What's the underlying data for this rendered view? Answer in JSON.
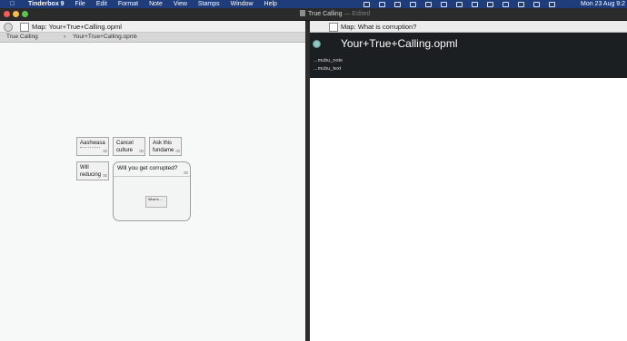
{
  "menubar": {
    "apple": "",
    "items": [
      "Tinderbox 9",
      "File",
      "Edit",
      "Format",
      "Note",
      "View",
      "Stamps",
      "Window",
      "Help"
    ],
    "clock": "Mon 23 Aug 9:2"
  },
  "window": {
    "title": "True Calling",
    "edited": "— Edited",
    "traffic_colors": [
      "#ee5f57",
      "#f3be4d",
      "#5dc453"
    ]
  },
  "left_pane": {
    "tab_title": "Map: Your+True+Calling.opml",
    "breadcrumbs": [
      "True Calling",
      "Your+True+Calling.opml"
    ],
    "notes": [
      {
        "text": "Aashwasa"
      },
      {
        "text": "Cancel culture"
      },
      {
        "text": "Ask this fundame"
      },
      {
        "text": "Will reducing"
      }
    ],
    "container": {
      "title": "Will you get corrupted?",
      "child": "What is ..."
    }
  },
  "right_pane": {
    "tab_title": "Map: What is corruption?",
    "note_title": "Your+True+Calling.opml",
    "attributes": [
      "...mubu_note",
      "...mubu_text"
    ],
    "bullet_color": "#8fc7c5"
  }
}
